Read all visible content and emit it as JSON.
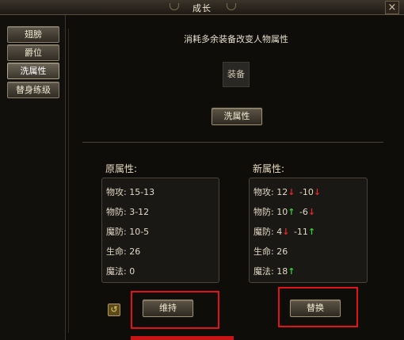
{
  "window": {
    "title": "成长",
    "close_label": "×"
  },
  "sidebar": {
    "items": [
      {
        "label": "翅膀",
        "active": false
      },
      {
        "label": "爵位",
        "active": false
      },
      {
        "label": "洗属性",
        "active": true
      },
      {
        "label": "替身练级",
        "active": false
      }
    ]
  },
  "main": {
    "hint": "消耗多余装备改变人物属性",
    "equip_slot_label": "装备",
    "reroll_button": "洗属性",
    "original": {
      "label": "原属性:",
      "rows": [
        {
          "name": "物攻:",
          "value": "15-13"
        },
        {
          "name": "物防:",
          "value": "3-12"
        },
        {
          "name": "魔防:",
          "value": "10-5"
        },
        {
          "name": "生命:",
          "value": "26"
        },
        {
          "name": "魔法:",
          "value": "0"
        }
      ]
    },
    "new": {
      "label": "新属性:",
      "rows": [
        {
          "name": "物攻:",
          "v1": "12",
          "a1": "down",
          "v2": "-10",
          "a2": "down"
        },
        {
          "name": "物防:",
          "v1": "10",
          "a1": "up",
          "v2": "-6",
          "a2": "down"
        },
        {
          "name": "魔防:",
          "v1": "4",
          "a1": "down",
          "v2": "-11",
          "a2": "up"
        },
        {
          "name": "生命:",
          "v1": "26",
          "a1": "",
          "v2": "",
          "a2": ""
        },
        {
          "name": "魔法:",
          "v1": "18",
          "a1": "up",
          "v2": "",
          "a2": ""
        }
      ]
    },
    "keep_button": "维持",
    "replace_button": "替换",
    "arrows": {
      "up": "↑",
      "down": "↓"
    },
    "colors": {
      "up": "#32d232",
      "down": "#e02828",
      "highlight": "#e01414"
    }
  }
}
